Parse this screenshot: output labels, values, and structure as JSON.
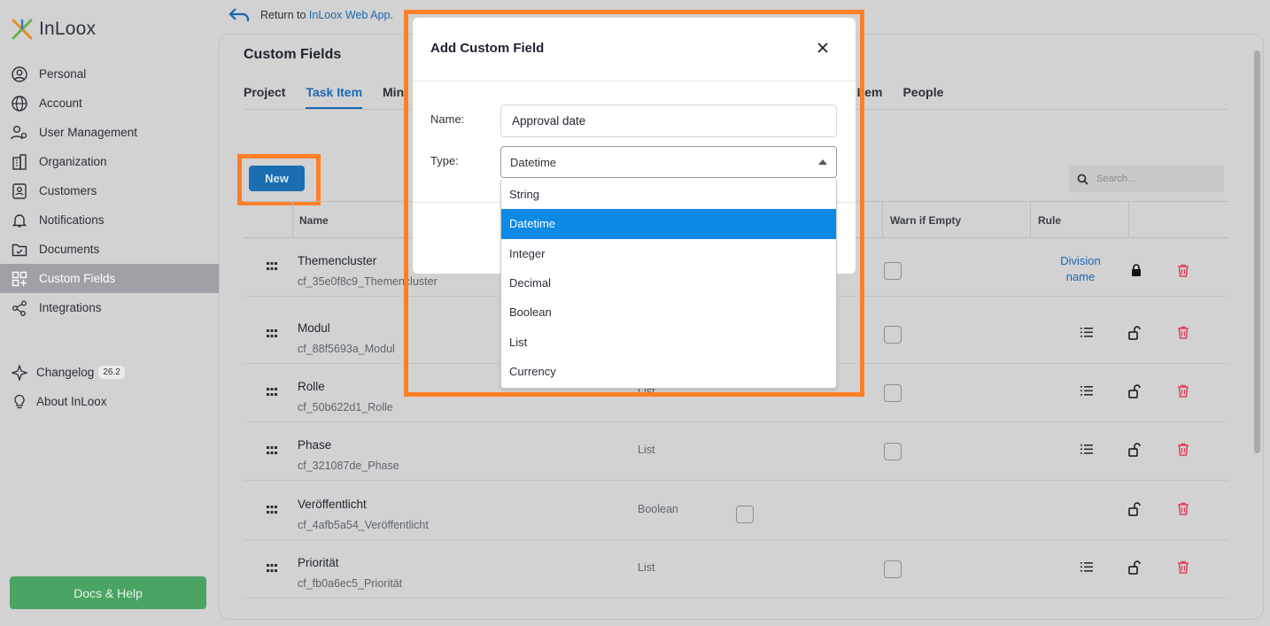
{
  "app": {
    "logo_text": "InLoox"
  },
  "sidebar": {
    "items": [
      {
        "label": "Personal",
        "icon": "person-icon"
      },
      {
        "label": "Account",
        "icon": "globe-icon"
      },
      {
        "label": "User Management",
        "icon": "users-icon"
      },
      {
        "label": "Organization",
        "icon": "building-icon"
      },
      {
        "label": "Customers",
        "icon": "contact-card-icon"
      },
      {
        "label": "Notifications",
        "icon": "bell-icon"
      },
      {
        "label": "Documents",
        "icon": "folder-icon"
      },
      {
        "label": "Custom Fields",
        "icon": "grid-plus-icon",
        "active": true
      },
      {
        "label": "Integrations",
        "icon": "share-nodes-icon"
      }
    ],
    "changelog": {
      "label": "Changelog",
      "badge": "26.2"
    },
    "about": {
      "label": "About InLoox"
    },
    "docs_button": "Docs & Help"
  },
  "return_link": {
    "prefix": "Return to ",
    "link": "InLoox Web App",
    "suffix": "."
  },
  "page": {
    "title": "Custom Fields",
    "tabs": [
      {
        "label": "Project"
      },
      {
        "label": "Task Item",
        "active": true
      },
      {
        "label": "Min"
      }
    ],
    "tabs_right": [
      {
        "label": "e Item"
      },
      {
        "label": "People"
      }
    ],
    "new_button": "New",
    "search_placeholder": "Search..."
  },
  "table": {
    "columns": {
      "name": "Name",
      "warn": "Warn if Empty",
      "rule": "Rule"
    },
    "rows": [
      {
        "name": "Themencluster",
        "id": "cf_35e0f8c9_Themencluster",
        "type": "",
        "rule_link": "Division name",
        "locked": true
      },
      {
        "name": "Modul",
        "id": "cf_88f5693a_Modul",
        "type": "",
        "locked": false
      },
      {
        "name": "Rolle",
        "id": "cf_50b622d1_Rolle",
        "type": "List",
        "locked": false
      },
      {
        "name": "Phase",
        "id": "cf_321087de_Phase",
        "type": "List",
        "locked": false
      },
      {
        "name": "Veröffentlicht",
        "id": "cf_4afb5a54_Veröffentlicht",
        "type": "Boolean",
        "locked": false
      },
      {
        "name": "Priorität",
        "id": "cf_fb0a6ec5_Priorität",
        "type": "List",
        "locked": false
      }
    ]
  },
  "modal": {
    "title": "Add Custom Field",
    "name_label": "Name:",
    "name_value": "Approval date",
    "type_label": "Type:",
    "type_value": "Datetime",
    "options": [
      "String",
      "Datetime",
      "Integer",
      "Decimal",
      "Boolean",
      "List",
      "Currency"
    ],
    "selected_option": "Datetime"
  },
  "colors": {
    "accent": "#1a67b0",
    "highlight": "#ff7f27",
    "selected": "#0d8ae6",
    "docs": "#4aa463",
    "danger": "#e0405a"
  }
}
